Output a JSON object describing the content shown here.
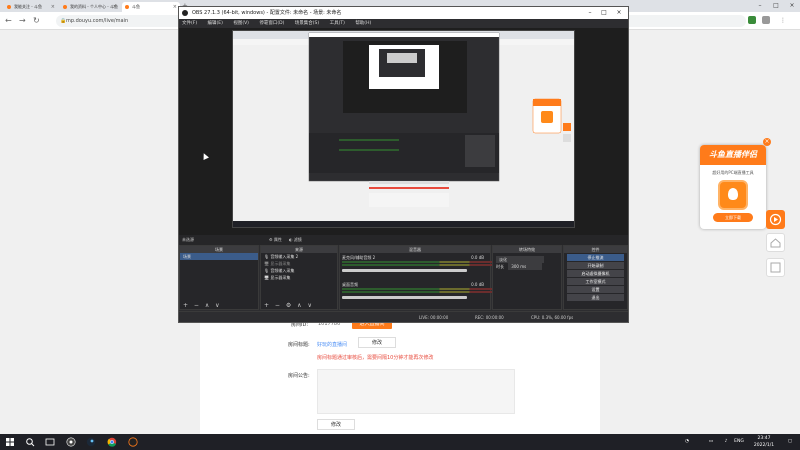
{
  "browser": {
    "tabs": [
      {
        "title": "我能关注 - 斗鱼",
        "color": "#ff7b1a",
        "active": false
      },
      {
        "title": "我的资料 - 个人中心 - 斗鱼",
        "color": "#ff7b1a",
        "active": false
      },
      {
        "title": "斗鱼",
        "color": "#ff7b1a",
        "active": true
      }
    ],
    "url": "mp.douyu.com/live/main"
  },
  "obs": {
    "title": "OBS 27.1.3 (64-bit, windows) - 配置文件: 未命名 - 场景: 未命名",
    "menu": [
      "文件(F)",
      "编辑(E)",
      "视图(V)",
      "停靠窗口(D)",
      "场景集合(S)",
      "工具(T)",
      "帮助(H)"
    ],
    "preview_bar": {
      "source_label": "未选源",
      "props": "属性",
      "filters": "滤镜"
    },
    "docks": {
      "scenes": {
        "title": "场景",
        "items": [
          "场景"
        ]
      },
      "sources": {
        "title": "来源",
        "items": [
          "音频输入采集 2",
          "显示器采集",
          "音频输入采集",
          "显示器采集"
        ]
      },
      "mixer": {
        "title": "混音器",
        "tracks": [
          {
            "name": "麦克风/辅助音频 2",
            "db": "0.0 dB"
          },
          {
            "name": "桌面音频",
            "db": "0.0 dB"
          }
        ]
      },
      "transitions": {
        "title": "转场特效",
        "type": "淡化",
        "duration_label": "时长",
        "duration": "300 ms"
      },
      "controls": {
        "title": "控件",
        "buttons": [
          "停止推流",
          "开始录制",
          "启动虚拟摄像机",
          "工作室模式",
          "设置",
          "退出"
        ]
      }
    },
    "status": {
      "live": "LIVE: 00:00:00",
      "rec": "REC: 00:00:00",
      "cpu": "CPU: 0.3%, 60.00 fps"
    }
  },
  "page": {
    "room_label": "房间ID:",
    "room_id": "1017780",
    "title_label": "房间标题:",
    "title_value": "好玩的直播间",
    "edit_label": "修改",
    "warning": "房间标题通过审核后，需要间隔10分钟才能再次修改",
    "notice_label": "房间公告:",
    "notice_edit": "修改",
    "start_btn": "进入直播间"
  },
  "ad": {
    "heading": "斗鱼直播伴侣",
    "sub": "超好用的PC端直播工具",
    "button": "立即下载"
  },
  "taskbar": {
    "lang": "ENG",
    "time": "23:47",
    "date": "2022/1/1"
  },
  "colors": {
    "accent": "#ff7b1a",
    "link": "#4a8ef5",
    "warning": "#e84a3c"
  }
}
